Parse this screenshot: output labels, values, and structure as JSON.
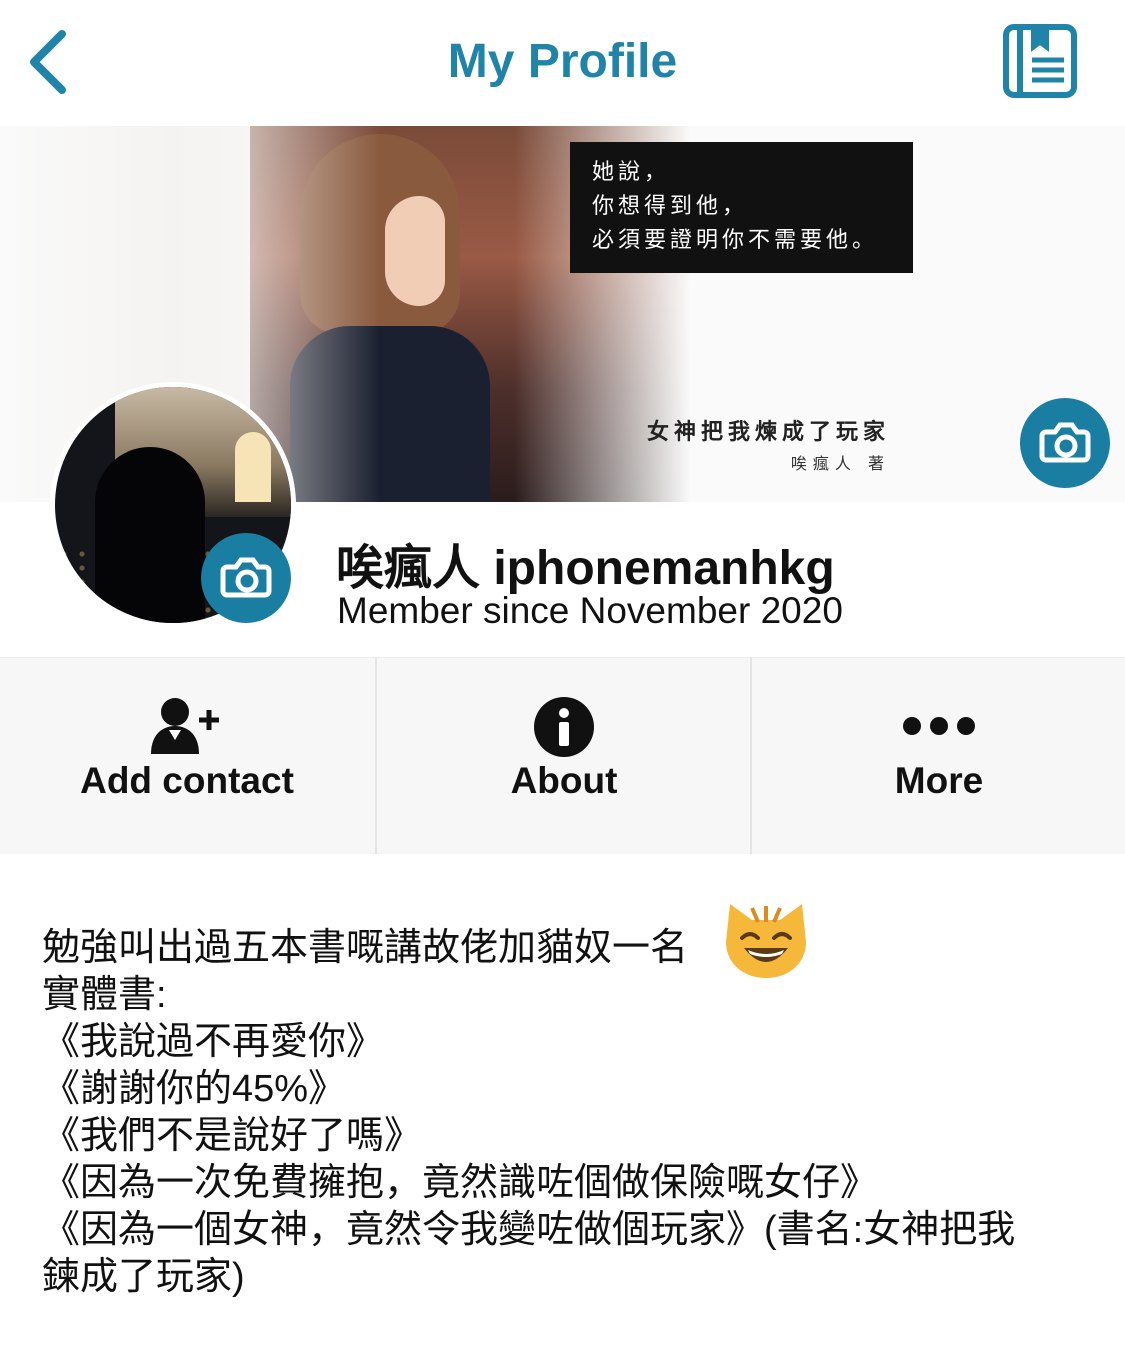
{
  "header": {
    "title": "My Profile",
    "back_icon": "chevron-left-icon",
    "right_icon": "log-book-icon",
    "accent": "#1f84a8"
  },
  "cover": {
    "quote_lines": [
      "她說，",
      "你想得到他，",
      "必須要證明你不需要他。"
    ],
    "book_title": "女神把我煉成了玩家",
    "book_author": "唉瘋人 著",
    "camera_icon": "camera-icon"
  },
  "profile": {
    "name": "唉瘋人 iphonemanhkg",
    "member_since": "Member since November 2020",
    "avatar_camera_icon": "camera-icon"
  },
  "actions": [
    {
      "label": "Add contact",
      "icon": "add-contact-icon"
    },
    {
      "label": "About",
      "icon": "info-icon"
    },
    {
      "label": "More",
      "icon": "more-dots-icon"
    }
  ],
  "bio": {
    "line1": "勉強叫出過五本書嘅講故佬加貓奴一名",
    "rest": "實體書:\n《我說過不再愛你》\n《謝謝你的45%》\n《我們不是說好了嗎》\n《因為一次免費擁抱，竟然識咗個做保險嘅女仔》\n《因為一個女神，竟然令我變咗做個玩家》(書名:女神把我\n鍊成了玩家)",
    "emoji": "grinning-cat-emoji"
  }
}
